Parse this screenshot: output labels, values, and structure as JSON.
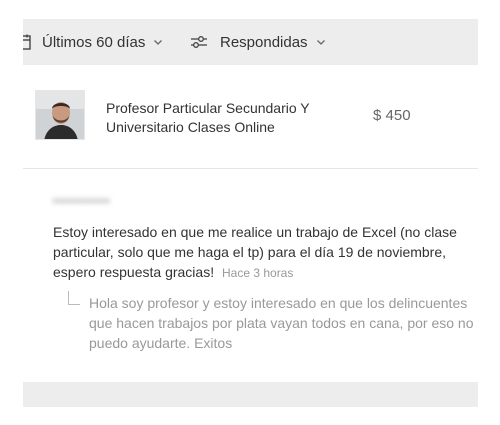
{
  "filters": {
    "period": {
      "label": "Últimos 60 días",
      "icon": "calendar-icon"
    },
    "status": {
      "label": "Respondidas",
      "icon": "sliders-icon"
    }
  },
  "product": {
    "title": "Profesor Particular Secundario Y Universitario Clases Online",
    "price": "$ 450",
    "thumbnail": "person-photo"
  },
  "question": {
    "asker": "•••••••••••",
    "text": "Estoy interesado en que me realice un trabajo de Excel (no clase particular, solo que me haga el tp) para el día 19 de noviembre, espero respuesta gracias!",
    "time": "Hace 3 horas"
  },
  "answer": {
    "text": "Hola soy profesor y estoy interesado en que los delincuentes que hacen trabajos por plata vayan todos en cana, por eso no puedo ayudarte. Exitos"
  },
  "colors": {
    "filter_bar_bg": "#ededed",
    "text_primary": "#333333",
    "text_muted": "#999999",
    "price": "#666666"
  }
}
